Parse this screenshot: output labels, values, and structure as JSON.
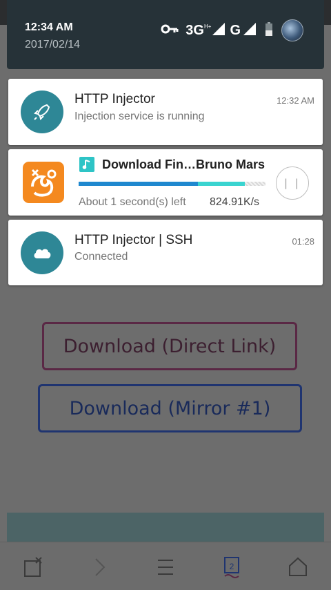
{
  "status_bar": {
    "time": "12:34 AM",
    "date": "2017/02/14",
    "network_1": "3G",
    "network_1_super": "H+",
    "network_2": "G",
    "icons": [
      "vpn-key-icon",
      "signal-icon",
      "signal-icon",
      "battery-icon",
      "avatar"
    ]
  },
  "notifications": [
    {
      "app_icon": "rocket-icon",
      "title": "HTTP Injector",
      "subtitle": "Injection service is running",
      "time": "12:32 AM"
    },
    {
      "app_icon": "uc-browser-icon",
      "file_icon": "music-note-icon",
      "title": "Download Fin…Bruno Mars",
      "time_left": "About 1 second(s) left",
      "speed": "824.91K/s",
      "progress_done": 0.64,
      "progress_buffer": 0.89,
      "pause_glyph": "| |"
    },
    {
      "app_icon": "cloud-icon",
      "title": "HTTP Injector | SSH",
      "subtitle": "Connected",
      "time": "01:28"
    }
  ],
  "background_page": {
    "download_direct": "Download (Direct Link)",
    "download_mirror": "Download (Mirror #1)"
  },
  "bottom_nav": {
    "tabs_count": "2",
    "icons": [
      "close-window-icon",
      "forward-icon",
      "menu-icon",
      "tabs-icon",
      "home-icon"
    ]
  },
  "colors": {
    "accent_teal": "#2e8796",
    "progress_blue": "#1f88cf",
    "progress_cyan": "#3ad4d0",
    "uc_orange": "#f4891f",
    "status_panel": "#263238"
  }
}
